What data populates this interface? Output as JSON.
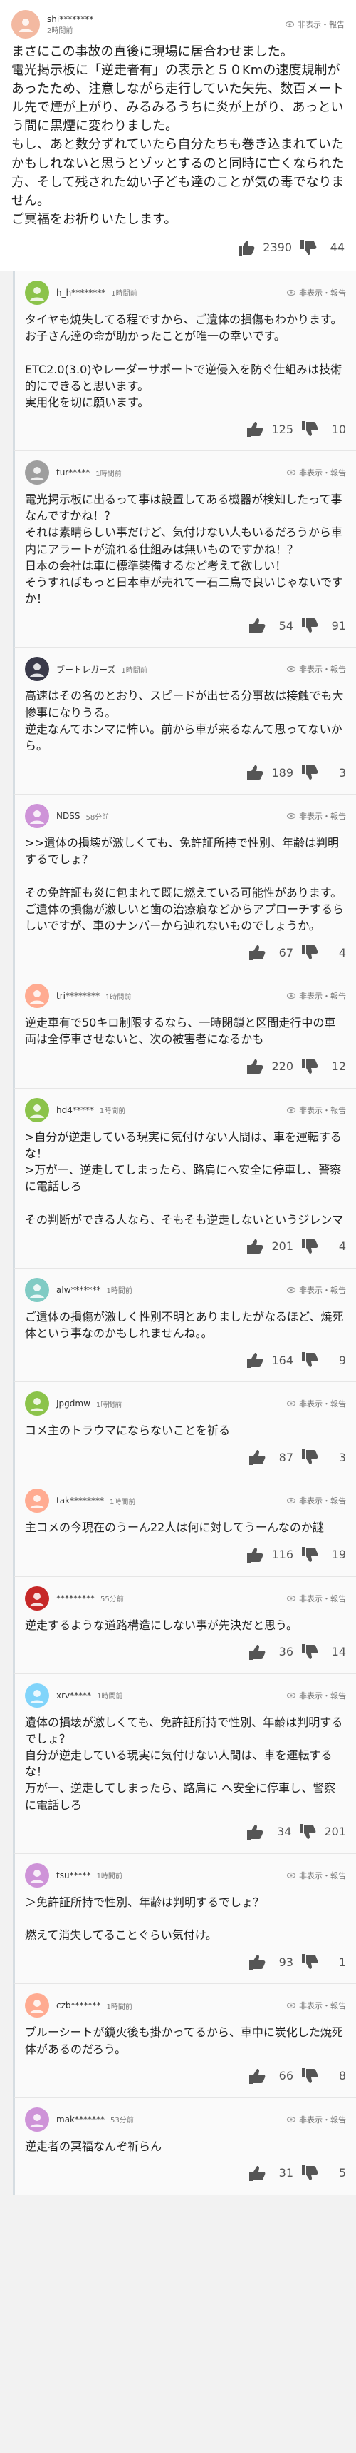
{
  "ui": {
    "report_label": "非表示・報告"
  },
  "colors": {
    "bg": "#f2f2f2",
    "text": "#222222",
    "muted": "#777777",
    "accent": "#2b2b2b"
  },
  "comments": [
    {
      "id": "c0",
      "user": "shi********",
      "time": "2時間前",
      "avatar_bg": "#f3b9a1",
      "avatar_icon": "user-avatar-icon",
      "text": "まさにこの事故の直後に現場に居合わせました。\n電光掲示板に「逆走者有」の表示と５０Kmの速度規制があったため、注意しながら走行していた矢先、数百メートル先で煙が上がり、みるみるうちに炎が上がり、あっという間に黒煙に変わりました。\nもし、あと数分ずれていたら自分たちも巻き込まれていたかもしれないと思うとゾッとするのと同時に亡くなられた方、そして残された幼い子ども達のことが気の毒でなりません。\nご冥福をお祈りいたします。",
      "likes": "2390",
      "dislikes": "44"
    },
    {
      "id": "c1",
      "user": "h_h********",
      "time": "1時間前",
      "avatar_bg": "#8bc34a",
      "avatar_icon": "smile-avatar-icon",
      "text": "タイヤも焼失してる程ですから、ご遺体の損傷もわかります。\nお子さん達の命が助かったことが唯一の幸いです。\n\nETC2.0(3.0)やレーダーサポートで逆侵入を防ぐ仕組みは技術的にできると思います。\n実用化を切に願います。",
      "likes": "125",
      "dislikes": "10"
    },
    {
      "id": "c2",
      "user": "tur*****",
      "time": "1時間前",
      "avatar_bg": "#9e9e9e",
      "avatar_icon": "user-avatar-icon",
      "text": "電光掲示板に出るって事は設置してある機器が検知したって事なんですかね！？\nそれは素晴らしい事だけど、気付けない人もいるだろうから車内にアラートが流れる仕組みは無いものですかね！？\n日本の会社は車に標準装備するなど考えて欲しい！\nそうすればもっと日本車が売れて一石二鳥で良いじゃないですか！",
      "likes": "54",
      "dislikes": "91"
    },
    {
      "id": "c3",
      "user": "ブートレガーズ",
      "time": "1時間前",
      "avatar_bg": "#3a3a4a",
      "avatar_icon": "image-avatar-icon",
      "text": "高速はその名のとおり、スピードが出せる分事故は接触でも大惨事になりうる。\n逆走なんてホンマに怖い。前から車が来るなんて思ってないから。",
      "likes": "189",
      "dislikes": "3"
    },
    {
      "id": "c4",
      "user": "NDSS",
      "time": "58分前",
      "avatar_bg": "#ce93d8",
      "avatar_icon": "smile-avatar-icon",
      "text": ">>遺体の損壊が激しくても、免許証所持で性別、年齢は判明するでしょ？\n\nその免許証も炎に包まれて既に燃えている可能性があります。ご遺体の損傷が激しいと歯の治療痕などからアプローチするらしいですが、車のナンバーから辿れないものでしょうか。",
      "likes": "67",
      "dislikes": "4"
    },
    {
      "id": "c5",
      "user": "tri********",
      "time": "1時間前",
      "avatar_bg": "#ffab91",
      "avatar_icon": "user-avatar-icon",
      "text": "逆走車有で50キロ制限するなら、一時閉鎖と区間走行中の車両は全停車させないと、次の被害者になるかも",
      "likes": "220",
      "dislikes": "12"
    },
    {
      "id": "c6",
      "user": "hd4*****",
      "time": "1時間前",
      "avatar_bg": "#8bc34a",
      "avatar_icon": "smile-avatar-icon",
      "text": ">自分が逆走している現実に気付けない人間は、車を運転するな！\n>万が一、逆走してしまったら、路肩にへ安全に停車し、警察に電話しろ\n\nその判断ができる人なら、そもそも逆走しないというジレンマ",
      "likes": "201",
      "dislikes": "4"
    },
    {
      "id": "c7",
      "user": "alw*******",
      "time": "1時間前",
      "avatar_bg": "#80cbc4",
      "avatar_icon": "user-avatar-icon",
      "text": "ご遺体の損傷が激しく性別不明とありましたがなるほど、焼死体という事なのかもしれませんね。。",
      "likes": "164",
      "dislikes": "9"
    },
    {
      "id": "c8",
      "user": "Jpgdmw",
      "time": "1時間前",
      "avatar_bg": "#8bc34a",
      "avatar_icon": "smile-avatar-icon",
      "text": "コメ主のトラウマにならないことを祈る",
      "likes": "87",
      "dislikes": "3"
    },
    {
      "id": "c9",
      "user": "tak********",
      "time": "1時間前",
      "avatar_bg": "#ffab91",
      "avatar_icon": "user-avatar-icon",
      "text": "主コメの今現在のうーん22人は何に対してうーんなのか謎",
      "likes": "116",
      "dislikes": "19"
    },
    {
      "id": "c10",
      "user": "*********",
      "time": "55分前",
      "avatar_bg": "#c62828",
      "avatar_icon": "image-avatar-icon",
      "text": "逆走するような道路構造にしない事が先決だと思う。",
      "likes": "36",
      "dislikes": "14"
    },
    {
      "id": "c11",
      "user": "xrv*****",
      "time": "1時間前",
      "avatar_bg": "#81d4fa",
      "avatar_icon": "smile-avatar-icon",
      "text": "遺体の損壊が激しくても、免許証所持で性別、年齢は判明するでしょ？\n自分が逆走している現実に気付けない人間は、車を運転するな！\n万が一、逆走してしまったら、路肩に へ安全に停車し、警察に電話しろ",
      "likes": "34",
      "dislikes": "201"
    },
    {
      "id": "c12",
      "user": "tsu*****",
      "time": "1時間前",
      "avatar_bg": "#ce93d8",
      "avatar_icon": "smile-avatar-icon",
      "text": "＞免許証所持で性別、年齢は判明するでしょ？\n\n燃えて消失してることぐらい気付け。",
      "likes": "93",
      "dislikes": "1"
    },
    {
      "id": "c13",
      "user": "czb*******",
      "time": "1時間前",
      "avatar_bg": "#ffab91",
      "avatar_icon": "user-avatar-icon",
      "text": "ブルーシートが鏡火後も掛かってるから、車中に炭化した焼死体があるのだろう。",
      "likes": "66",
      "dislikes": "8"
    },
    {
      "id": "c14",
      "user": "mak*******",
      "time": "53分前",
      "avatar_bg": "#ce93d8",
      "avatar_icon": "smile-avatar-icon",
      "text": "逆走者の冥福なんぞ祈らん",
      "likes": "31",
      "dislikes": "5"
    }
  ]
}
